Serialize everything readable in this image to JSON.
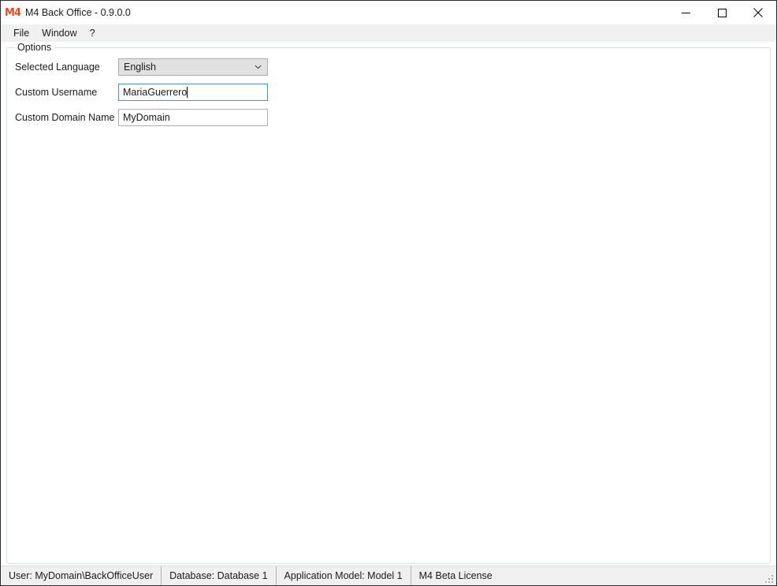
{
  "window": {
    "title": "M4 Back Office - 0.9.0.0",
    "icon": "m4-logo-icon",
    "icon_text": "M4",
    "accent_color": "#e8491f",
    "controls": {
      "minimize": "minimize-icon",
      "maximize": "maximize-icon",
      "close": "close-icon"
    }
  },
  "menubar": {
    "items": [
      {
        "label": "File"
      },
      {
        "label": "Window"
      },
      {
        "label": "?"
      }
    ]
  },
  "options_group": {
    "title": "Options",
    "fields": [
      {
        "label": "Selected Language",
        "type": "combobox",
        "value": "English",
        "focused": false
      },
      {
        "label": "Custom Username",
        "type": "text",
        "value": "MariaGuerrero",
        "focused": true
      },
      {
        "label": "Custom Domain Name",
        "type": "text",
        "value": "MyDomain",
        "focused": false
      }
    ]
  },
  "statusbar": {
    "cells": [
      {
        "label": "User: MyDomain\\BackOfficeUser"
      },
      {
        "label": "Database: Database 1"
      },
      {
        "label": "Application Model: Model 1"
      },
      {
        "label": "M4 Beta License"
      }
    ]
  }
}
